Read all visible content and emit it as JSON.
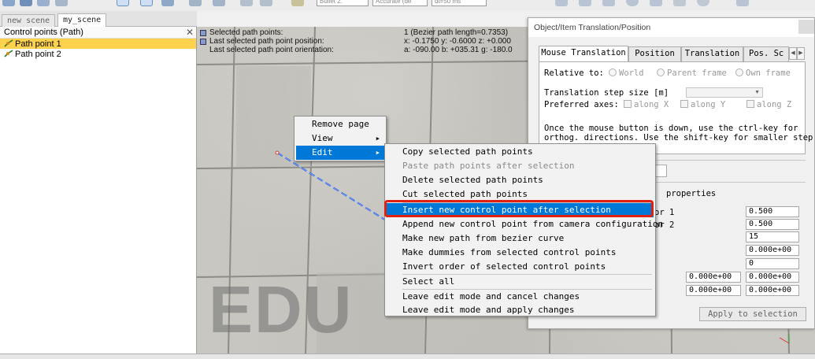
{
  "toolbar": {
    "selects": [
      "Bullet 2.",
      "Accurate (de",
      "dt=50 ms"
    ]
  },
  "scene_tabs": [
    {
      "label": "new scene",
      "active": false
    },
    {
      "label": "my_scene",
      "active": true
    }
  ],
  "hierarchy": {
    "title": "Control points (Path)",
    "items": [
      {
        "label": "Path point 1",
        "selected": true,
        "icon": "path-point-icon"
      },
      {
        "label": "Path point 2",
        "selected": false,
        "icon": "path-point-icon"
      }
    ]
  },
  "info": {
    "row1_label": "Selected path points:",
    "row1_value": "1 (Bezier path length=0.7353)",
    "row2_label": "Last selected path point position:",
    "row2_value": "x: -0.1750   y: -0.6000   z: +0.000",
    "row3_label": "Last selected path point orientation:",
    "row3_value": "a: -090.00   b: +035.31   g: -180.0"
  },
  "watermark": "EDU",
  "dialog": {
    "title": "Object/Item Translation/Position",
    "tabs": [
      "Mouse Translation",
      "Position",
      "Translation",
      "Pos. Sc"
    ],
    "relative_to_label": "Relative to:",
    "relative_options": [
      "World",
      "Parent frame",
      "Own frame"
    ],
    "step_label": "Translation step size [m]",
    "axes_label": "Preferred axes:",
    "axes": [
      "along X",
      "along Y",
      "along Z"
    ],
    "help_line1": "Once the mouse button is down, use the ctrl-key for",
    "help_line2": "orthog. directions. Use the shift-key for smaller step",
    "props_label": "properties",
    "row_labels": [
      "or 1",
      "or 2"
    ],
    "values": [
      "0.500",
      "0.500",
      "15",
      "0.000e+00",
      "0",
      "0.000e+00",
      "0.000e+00"
    ],
    "left_values": [
      "0.000e+00",
      "0.000e+00"
    ],
    "apply_label": "Apply to selection"
  },
  "context_menu": {
    "items": [
      "Remove page",
      "View",
      "Edit"
    ]
  },
  "edit_submenu": {
    "items": [
      "Copy selected path points",
      "Paste path points after selection",
      "Delete selected path points",
      "Cut selected path points",
      "Insert new control point after selection",
      "Append new control point from camera configuration",
      "Make new path from bezier curve",
      "Make dummies from selected control points",
      "Invert order of selected control points",
      "Select all",
      "Leave edit mode and cancel changes",
      "Leave edit mode and apply changes"
    ],
    "highlighted_index": 4,
    "disabled_index": 1
  },
  "colors": {
    "highlight": "#0078d7",
    "selection": "#ffd24d",
    "callout": "#e02010",
    "path_line": "#2255dd"
  }
}
